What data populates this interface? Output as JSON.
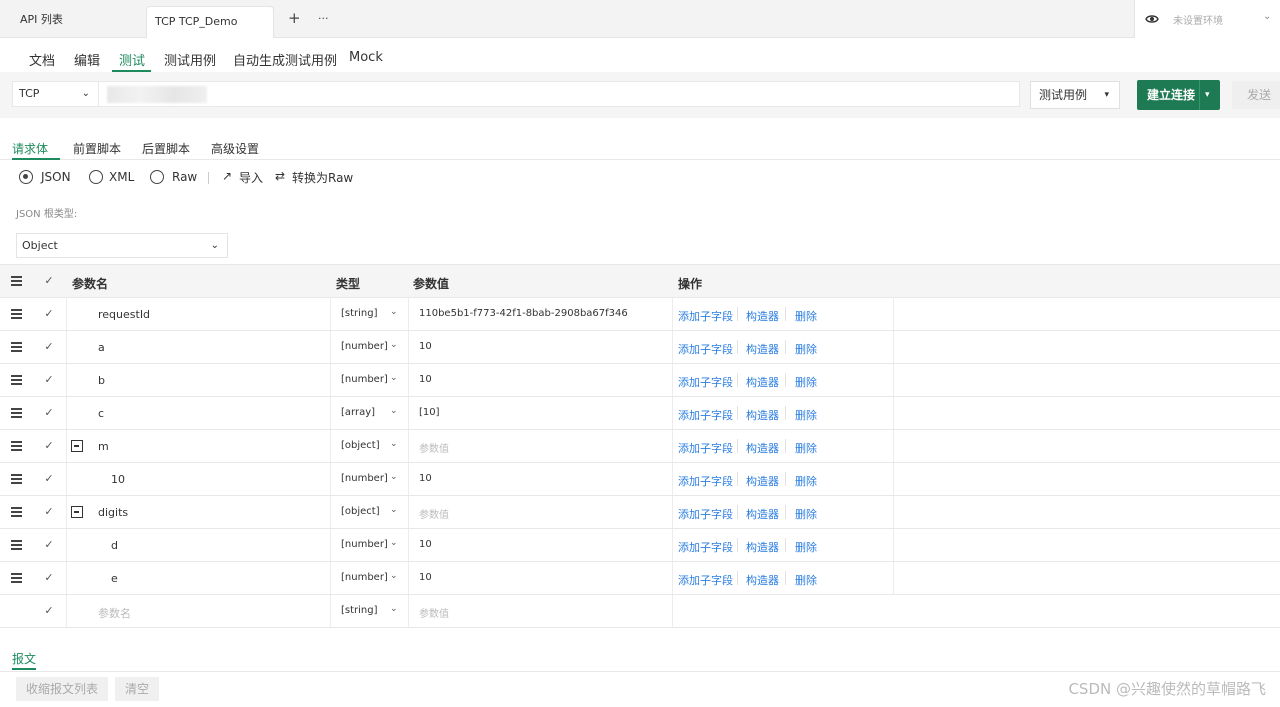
{
  "top_tabs": {
    "api_list": "API 列表",
    "current_tab": "TCP TCP_Demo",
    "add": "+",
    "more": "···"
  },
  "env": {
    "placeholder": "未设置环境",
    "chevron": "⌄"
  },
  "nav": [
    "文档",
    "编辑",
    "测试",
    "测试用例",
    "自动生成测试用例",
    "Mock"
  ],
  "nav_active": 2,
  "address": {
    "protocol": "TCP",
    "chevron": "⌄",
    "case_select": "测试用例",
    "case_chevron": "▾",
    "connect": "建立连接",
    "connect_chevron": "▾",
    "send": "发送"
  },
  "body_tabs": [
    "请求体",
    "前置脚本",
    "后置脚本",
    "高级设置"
  ],
  "formats": {
    "json": "JSON",
    "xml": "XML",
    "raw": "Raw",
    "import": "导入",
    "convert": "转换为Raw",
    "import_icon": "↗",
    "convert_icon": "⇄"
  },
  "root": {
    "label": "JSON 根类型:",
    "value": "Object",
    "chevron": "⌄"
  },
  "table": {
    "headers": {
      "name": "参数名",
      "type": "类型",
      "value": "参数值",
      "action": "操作"
    },
    "check": "✓",
    "type_chevron": "⌄",
    "actions": {
      "add_child": "添加子字段",
      "builder": "构造器",
      "delete": "删除"
    },
    "rows": [
      {
        "name": "requestId",
        "type": "[string]",
        "value": "110be5b1-f773-42f1-8bab-2908ba67f346"
      },
      {
        "name": "a",
        "type": "[number]",
        "value": "10"
      },
      {
        "name": "b",
        "type": "[number]",
        "value": "10"
      },
      {
        "name": "c",
        "type": "[array]",
        "value": "[10]"
      },
      {
        "name": "m",
        "type": "[object]",
        "value": "参数值"
      },
      {
        "name": "10",
        "type": "[number]",
        "value": "10"
      },
      {
        "name": "digits",
        "type": "[object]",
        "value": "参数值"
      },
      {
        "name": "d",
        "type": "[number]",
        "value": "10"
      },
      {
        "name": "e",
        "type": "[number]",
        "value": "10"
      }
    ],
    "empty_row": {
      "name": "参数名",
      "type": "[string]",
      "value": "参数值"
    }
  },
  "bottom": {
    "message_tab": "报文",
    "collapse_list": "收缩报文列表",
    "clear": "清空",
    "watermark": "CSDN @兴趣使然的草帽路飞"
  }
}
